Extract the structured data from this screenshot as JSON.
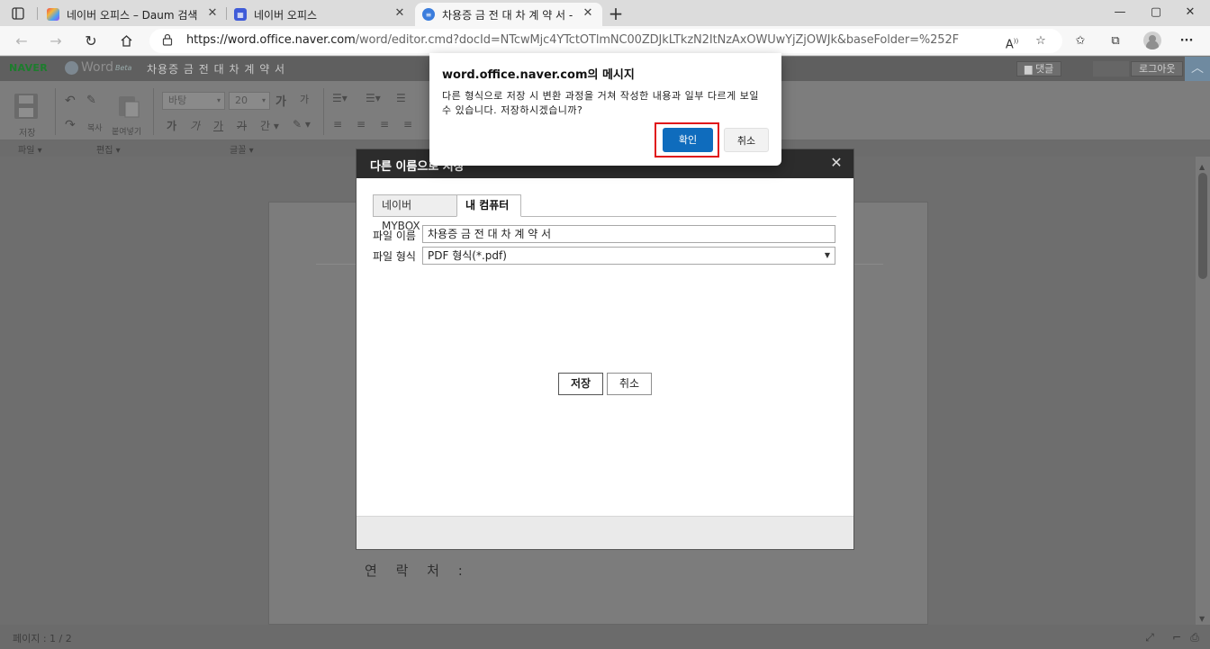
{
  "browser": {
    "tabs": [
      {
        "title": "네이버 오피스 – Daum 검색",
        "favicon": "daum-favicon",
        "active": false
      },
      {
        "title": "네이버 오피스",
        "favicon": "naver-office-favicon",
        "active": false
      },
      {
        "title": "차용증 금 전 대 차 계 약 서 - 네이",
        "favicon": "naver-word-favicon",
        "active": true
      }
    ],
    "url_host": "https://word.office.naver.com",
    "url_rest": "/word/editor.cmd?docId=NTcwMjc4YTctOTlmNC00ZDJkLTkzN2ItNzAxOWUwYjZjOWJk&baseFolder=%252F",
    "icons": {
      "tab_actions": "tab-actions-icon",
      "new_tab": "plus-icon",
      "read_aloud": "read-aloud-icon",
      "favorite": "add-favorite-icon",
      "favorites": "favorites-icon",
      "collections": "collections-icon",
      "profile": "profile-avatar",
      "more": "more-icon"
    }
  },
  "app": {
    "brand": "NAVER",
    "product": "Word",
    "product_badge": "Beta",
    "doc_title": "차용증 금 전 대 차 계 약 서",
    "comment_button": "댓글",
    "logout_button": "로그아웃",
    "toolbar": {
      "save_label": "저장",
      "cut_label": "복사",
      "paste_label": "붙여넣기",
      "font_name": "바탕",
      "font_size": "20"
    },
    "ribbon_labels": [
      "파일 ▾",
      "편집 ▾",
      "글꼴 ▾"
    ],
    "page_text": "연 락 처 :",
    "status": {
      "page_info": "페이지 : 1 / 2"
    }
  },
  "save_dialog": {
    "title": "다른 이름으로 저장",
    "tabs": [
      {
        "label": "네이버 MYBOX",
        "selected": false
      },
      {
        "label": "내 컴퓨터",
        "selected": true
      }
    ],
    "filename_label": "파일 이름",
    "filename_value": "차용증 금 전 대 차 계 약 서",
    "format_label": "파일 형식",
    "format_value": "PDF 형식(*.pdf)",
    "save_button": "저장",
    "cancel_button": "취소"
  },
  "alert": {
    "host": "word.office.naver.com의 메시지",
    "message": "다른 형식으로 저장 시 변환 과정을 거쳐 작성한 내용과 일부 다르게 보일 수 있습니다. 저장하시겠습니까?",
    "ok_button": "확인",
    "cancel_button": "취소"
  },
  "colors": {
    "ok_button": "#0f6cbd",
    "highlight": "#e0151a",
    "dialog_title_bg": "#2c2c2c"
  }
}
